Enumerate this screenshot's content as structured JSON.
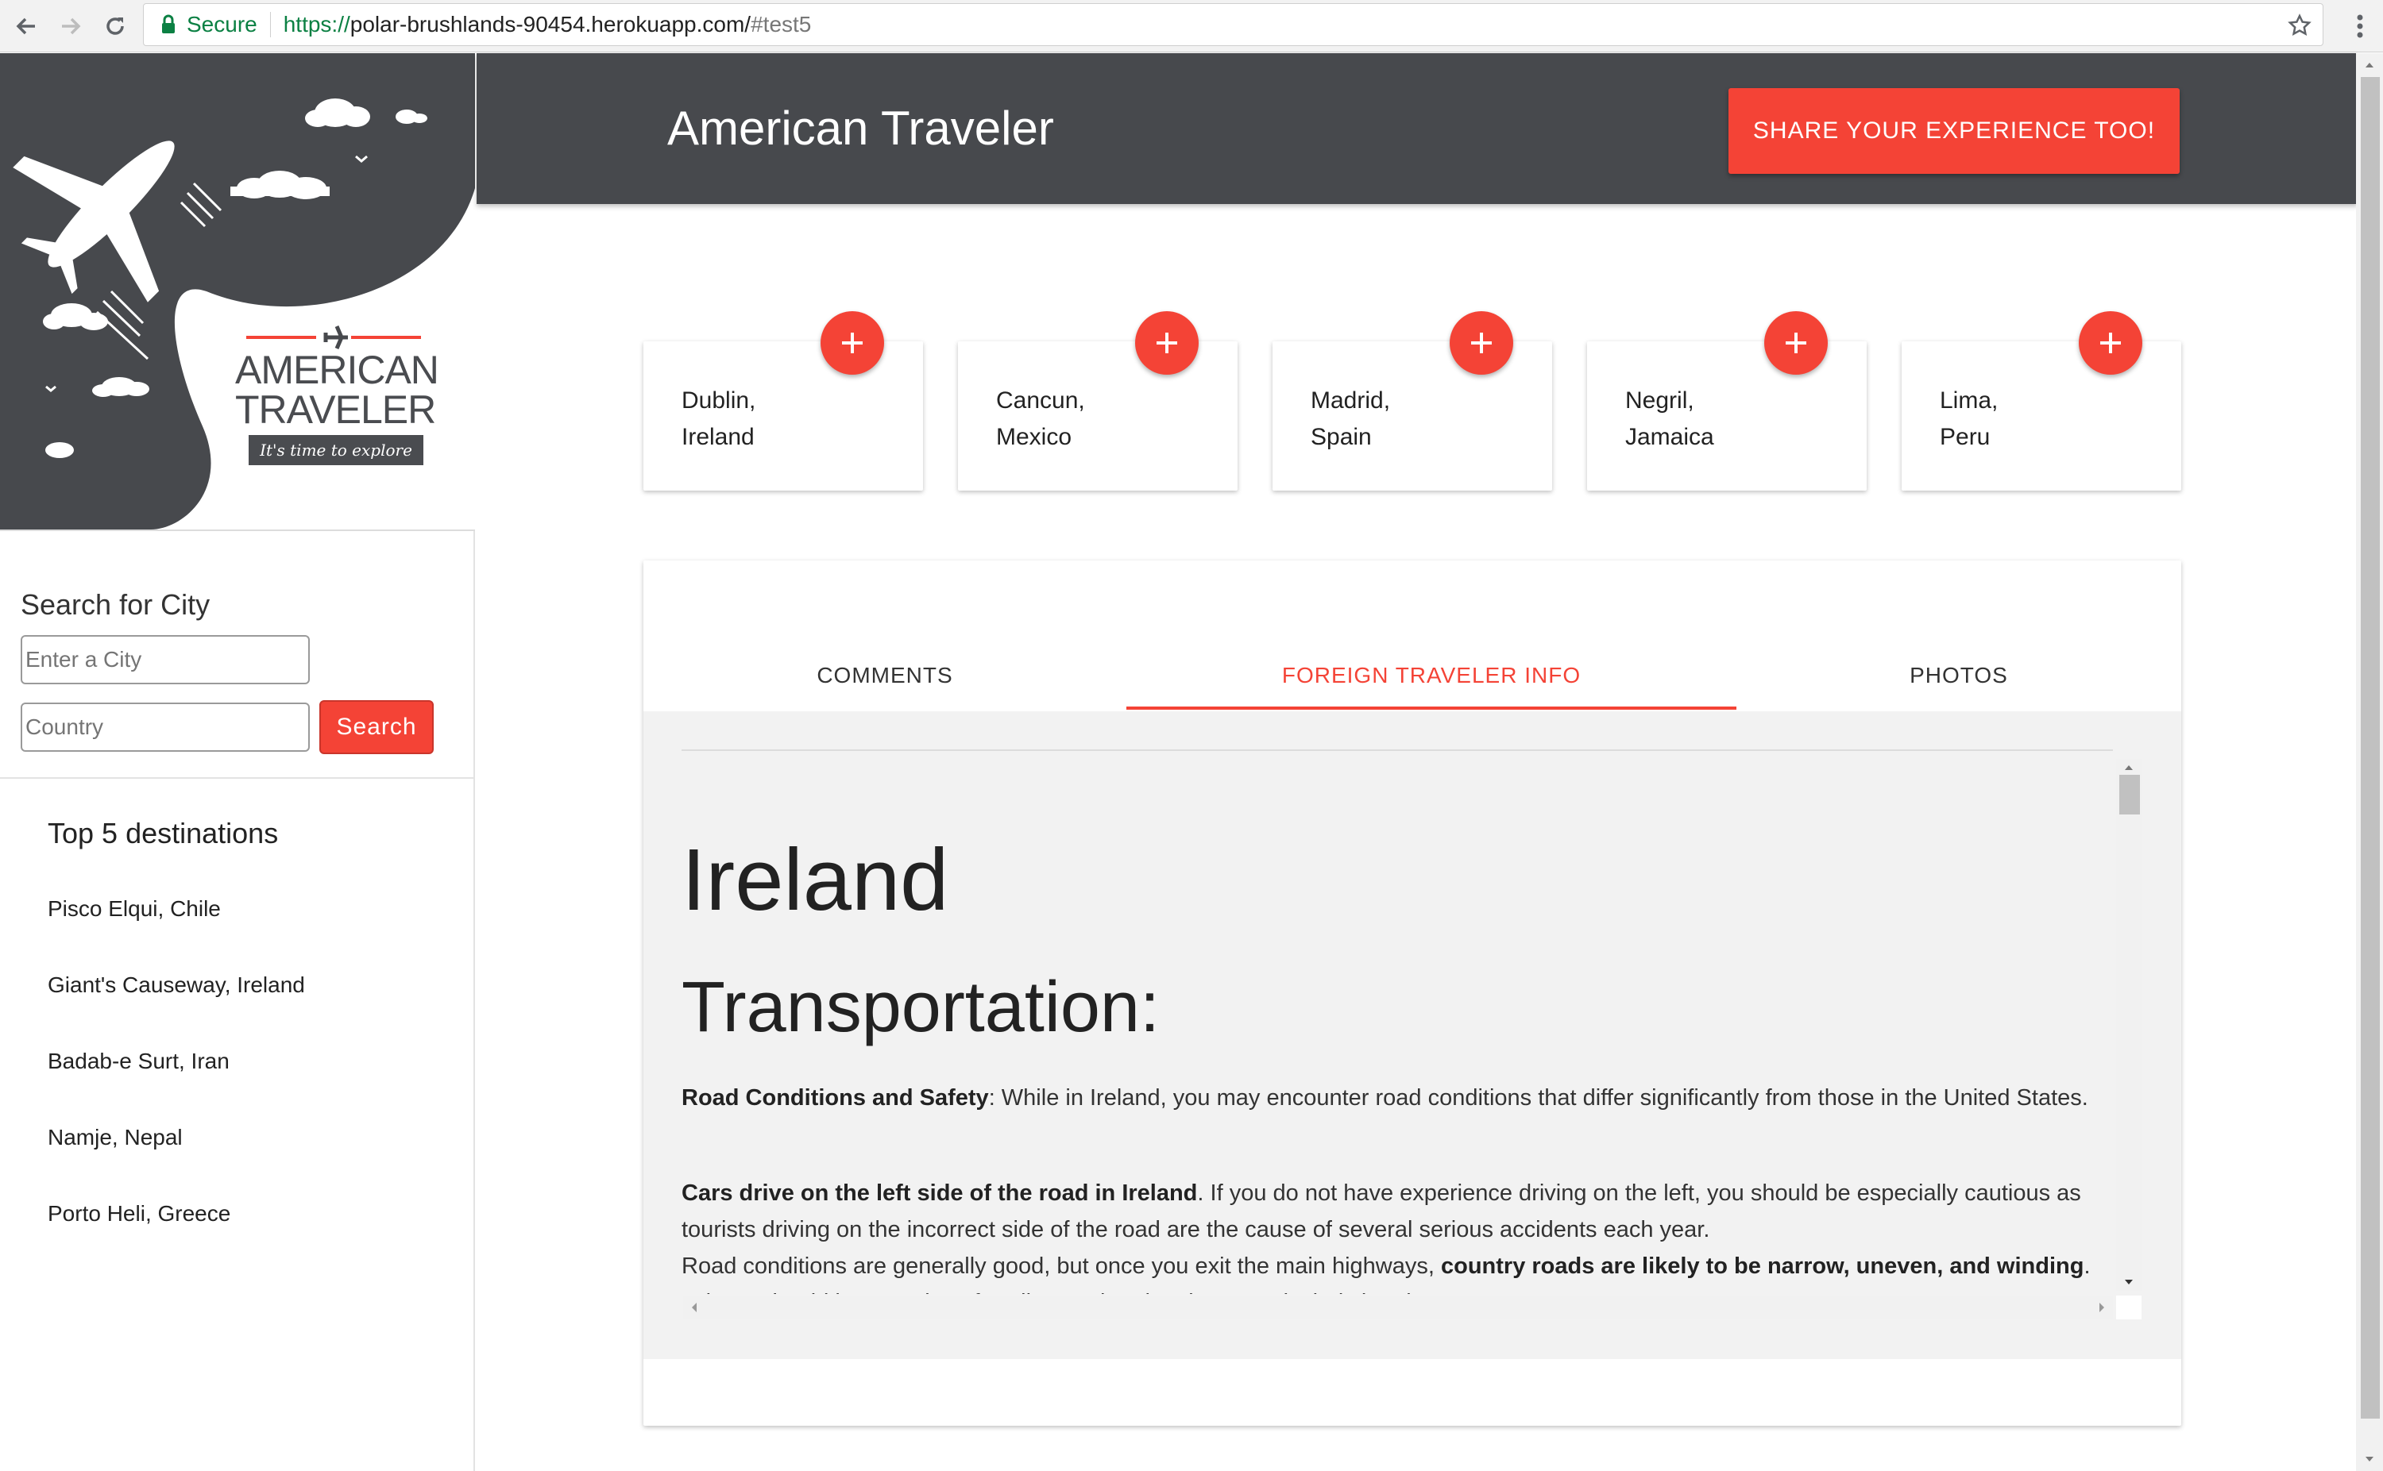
{
  "browser": {
    "secure_label": "Secure",
    "url_scheme": "https://",
    "url_host": "polar-brushlands-90454.herokuapp.com/",
    "url_hash": "#test5"
  },
  "logo": {
    "line1": "AMERICAN",
    "line2": "TRAVELER",
    "tagline": "It's time to explore"
  },
  "search": {
    "title": "Search for City",
    "city_placeholder": "Enter a City",
    "country_placeholder": "Country",
    "button_label": "Search"
  },
  "top_destinations": {
    "title": "Top 5 destinations",
    "items": [
      "Pisco Elqui, Chile",
      "Giant's Causeway, Ireland",
      "Badab-e Surt, Iran",
      "Namje, Nepal",
      "Porto Heli, Greece"
    ]
  },
  "header": {
    "brand": "American Traveler",
    "share_button": "SHARE YOUR EXPERIENCE TOO!"
  },
  "cities": [
    {
      "city": "Dublin,",
      "country": "Ireland"
    },
    {
      "city": "Cancun,",
      "country": "Mexico"
    },
    {
      "city": "Madrid,",
      "country": "Spain"
    },
    {
      "city": "Negril,",
      "country": "Jamaica"
    },
    {
      "city": "Lima,",
      "country": "Peru"
    }
  ],
  "tabs": {
    "items": [
      "COMMENTS",
      "FOREIGN TRAVELER INFO",
      "PHOTOS"
    ],
    "active": "FOREIGN TRAVELER INFO"
  },
  "info": {
    "country": "Ireland",
    "section": "Transportation:",
    "p1_bold": "Road Conditions and Safety",
    "p1_text": ":  While in Ireland, you may encounter road conditions that differ significantly from those in the United States.",
    "p2_bold": "Cars drive on the left side of the road in Ireland",
    "p2_text": ". If you do not have experience driving on the left, you should be especially cautious as tourists driving on the incorrect side of the road are the cause of several serious accidents each year.",
    "p3_text": "Road conditions are generally good, but once you exit the main highways, ",
    "p3_bold": "country roads are likely to be narrow, uneven, and winding",
    "p3_tail": ". Drivers should be attentive of cyclists and pedestrians, particularly in urban areas."
  },
  "colors": {
    "accent": "#f44336",
    "header_bg": "#47494d",
    "secure_green": "#0b8043"
  }
}
